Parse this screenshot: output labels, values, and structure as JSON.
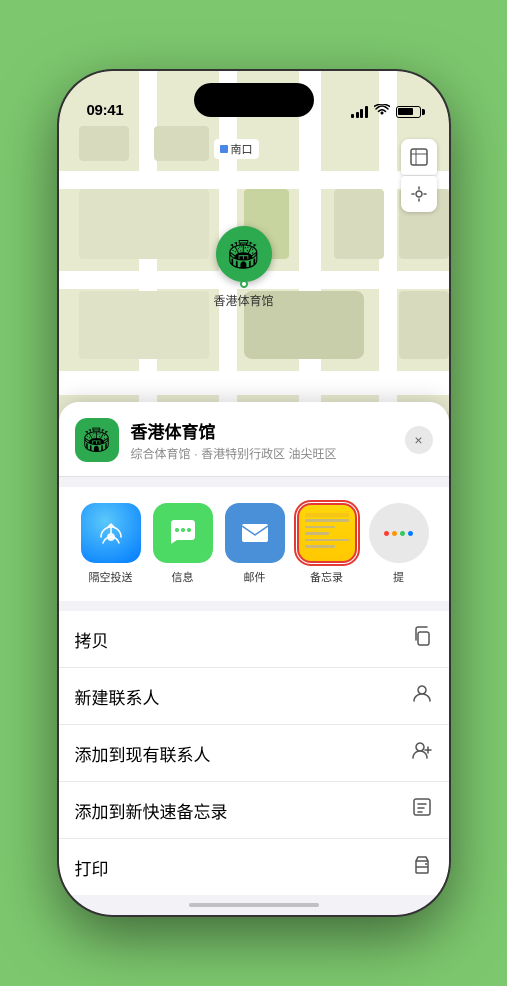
{
  "status_bar": {
    "time": "09:41",
    "location_arrow": "▶"
  },
  "map": {
    "label_text": "南口",
    "venue_name_on_map": "香港体育馆"
  },
  "venue_card": {
    "name": "香港体育馆",
    "subtitle": "综合体育馆 · 香港特别行政区 油尖旺区",
    "close_label": "×"
  },
  "share_apps": [
    {
      "id": "airdrop",
      "label": "隔空投送",
      "icon": "📡"
    },
    {
      "id": "messages",
      "label": "信息",
      "icon": "💬"
    },
    {
      "id": "mail",
      "label": "邮件",
      "icon": "✉️"
    },
    {
      "id": "notes",
      "label": "备忘录",
      "icon": ""
    },
    {
      "id": "more",
      "label": "提",
      "icon": ""
    }
  ],
  "actions": [
    {
      "label": "拷贝",
      "icon": "copy"
    },
    {
      "label": "新建联系人",
      "icon": "person"
    },
    {
      "label": "添加到现有联系人",
      "icon": "person-add"
    },
    {
      "label": "添加到新快速备忘录",
      "icon": "note"
    },
    {
      "label": "打印",
      "icon": "print"
    }
  ]
}
